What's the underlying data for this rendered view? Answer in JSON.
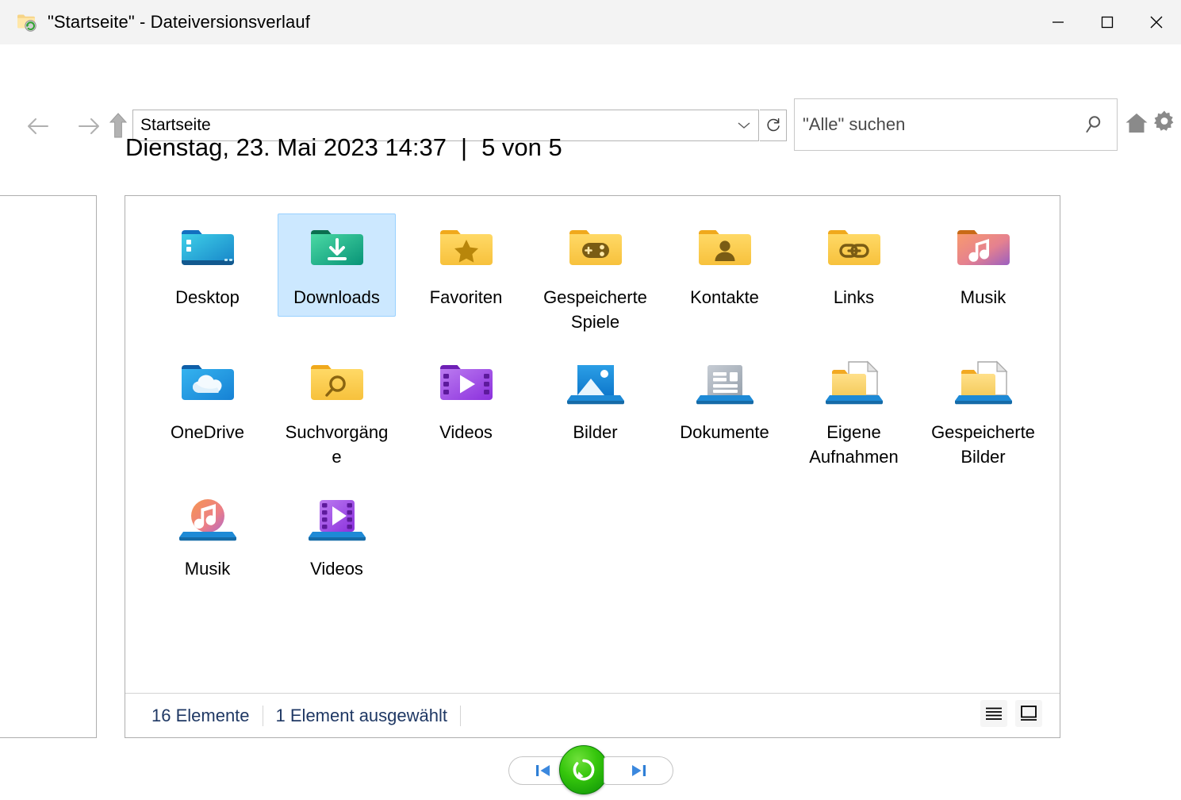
{
  "window": {
    "title": "\"Startseite\" - Dateiversionsverlauf",
    "icon": "folder-clock-icon",
    "minimize_label": "Minimieren",
    "maximize_label": "Maximieren",
    "close_label": "Schließen"
  },
  "toolbar": {
    "back_icon": "arrow-left-icon",
    "forward_icon": "arrow-right-icon",
    "up_icon": "arrow-up-icon",
    "address_value": "Startseite",
    "address_chevron_icon": "chevron-down-icon",
    "refresh_icon": "refresh-icon",
    "search_placeholder": "\"Alle\" suchen",
    "search_value": "",
    "search_icon": "search-icon",
    "home_icon": "home-icon",
    "settings_icon": "gear-icon"
  },
  "header": {
    "date": "Dienstag, 23. Mai 2023 14:37",
    "separator": "|",
    "position": "5 von 5"
  },
  "items": [
    {
      "label": "Desktop",
      "icon": "desktop-folder-icon",
      "selected": false,
      "row": 1
    },
    {
      "label": "Downloads",
      "icon": "downloads-folder-icon",
      "selected": true,
      "row": 1
    },
    {
      "label": "Favoriten",
      "icon": "favorites-folder-icon",
      "selected": false,
      "row": 1
    },
    {
      "label": "Gespeicherte Spiele",
      "icon": "saved-games-folder-icon",
      "selected": false,
      "row": 1
    },
    {
      "label": "Kontakte",
      "icon": "contacts-folder-icon",
      "selected": false,
      "row": 1
    },
    {
      "label": "Links",
      "icon": "links-folder-icon",
      "selected": false,
      "row": 1
    },
    {
      "label": "Musik",
      "icon": "music-folder-icon",
      "selected": false,
      "row": 1
    },
    {
      "label": "OneDrive",
      "icon": "onedrive-folder-icon",
      "selected": false,
      "row": 2
    },
    {
      "label": "Suchvorgänge",
      "icon": "searches-folder-icon",
      "selected": false,
      "row": 2
    },
    {
      "label": "Videos",
      "icon": "videos-folder-icon",
      "selected": false,
      "row": 2
    },
    {
      "label": "Bilder",
      "icon": "pictures-library-icon",
      "selected": false,
      "row": 2
    },
    {
      "label": "Dokumente",
      "icon": "documents-library-icon",
      "selected": false,
      "row": 2
    },
    {
      "label": "Eigene Aufnahmen",
      "icon": "camera-roll-library-icon",
      "selected": false,
      "row": 2
    },
    {
      "label": "Gespeicherte Bilder",
      "icon": "saved-pictures-library-icon",
      "selected": false,
      "row": 2
    },
    {
      "label": "Musik",
      "icon": "music-library-icon",
      "selected": false,
      "row": 3
    },
    {
      "label": "Videos",
      "icon": "videos-library-icon",
      "selected": false,
      "row": 3
    }
  ],
  "status": {
    "count": "16 Elemente",
    "selection": "1 Element ausgewählt",
    "view_details_icon": "details-view-icon",
    "view_large_icons_icon": "large-icons-view-icon"
  },
  "controls": {
    "previous_icon": "skip-previous-icon",
    "previous_label": "Vorherige Version",
    "restore_icon": "restore-icon",
    "restore_label": "Wiederherstellen",
    "next_icon": "skip-next-icon",
    "next_label": "Nächste Version"
  },
  "colors": {
    "titlebar_bg": "#f3f3f3",
    "selection_bg": "#cce8ff",
    "selection_border": "#99d1ff",
    "status_text": "#1f3864",
    "restore_green": "#2dbb0a",
    "card_border": "#aeaeae"
  }
}
